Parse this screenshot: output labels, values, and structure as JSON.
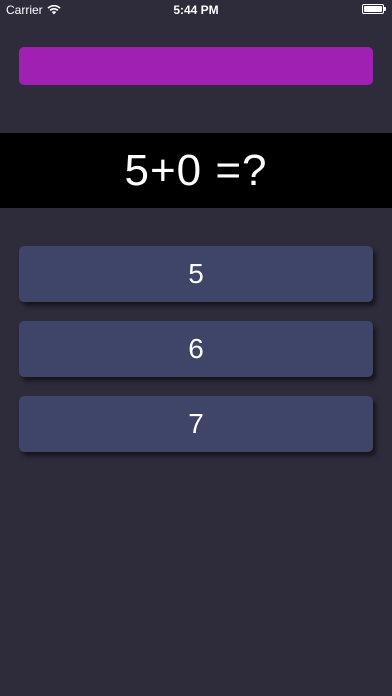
{
  "status_bar": {
    "carrier": "Carrier",
    "time": "5:44 PM",
    "wifi_icon": "wifi-icon",
    "battery_icon": "battery-icon"
  },
  "progress": {
    "fraction": 1.0,
    "color": "#a020b3"
  },
  "question": {
    "text": "5+0 =?"
  },
  "answers": [
    {
      "label": "5"
    },
    {
      "label": "6"
    },
    {
      "label": "7"
    }
  ],
  "colors": {
    "background": "#2e2c3b",
    "question_band": "#000000",
    "answer_button": "#3e4568"
  }
}
